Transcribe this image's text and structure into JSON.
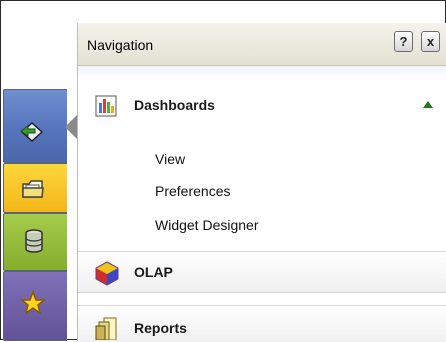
{
  "panel": {
    "title": "Navigation",
    "help_label": "?",
    "close_label": "x"
  },
  "sections": {
    "dashboards": {
      "label": "Dashboards",
      "icon": "dashboards-chart-icon",
      "expanded": true,
      "items": [
        {
          "label": "View"
        },
        {
          "label": "Preferences"
        },
        {
          "label": "Widget Designer"
        }
      ]
    },
    "olap": {
      "label": "OLAP",
      "icon": "olap-cube-icon"
    },
    "reports": {
      "label": "Reports",
      "icon": "reports-icon"
    }
  },
  "side_tabs": [
    {
      "name": "dashboards",
      "icon": "arrow-card-icon",
      "color": "#5574bd",
      "selected": true
    },
    {
      "name": "documents",
      "icon": "folder-icon",
      "color": "#f2b61a"
    },
    {
      "name": "data",
      "icon": "database-icon",
      "color": "#85ad2c"
    },
    {
      "name": "favorites",
      "icon": "star-icon",
      "color": "#625298"
    }
  ],
  "colors": {
    "collapse_arrow": "#1c7a1c",
    "header_bg": "#e9e7da"
  }
}
